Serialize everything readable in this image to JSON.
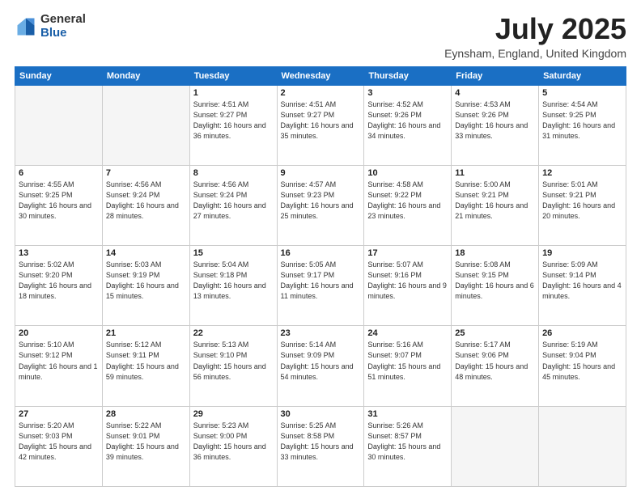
{
  "header": {
    "logo_line1": "General",
    "logo_line2": "Blue",
    "month": "July 2025",
    "location": "Eynsham, England, United Kingdom"
  },
  "days_of_week": [
    "Sunday",
    "Monday",
    "Tuesday",
    "Wednesday",
    "Thursday",
    "Friday",
    "Saturday"
  ],
  "weeks": [
    [
      {
        "day": "",
        "sunrise": "",
        "sunset": "",
        "daylight": ""
      },
      {
        "day": "",
        "sunrise": "",
        "sunset": "",
        "daylight": ""
      },
      {
        "day": "1",
        "sunrise": "Sunrise: 4:51 AM",
        "sunset": "Sunset: 9:27 PM",
        "daylight": "Daylight: 16 hours and 36 minutes."
      },
      {
        "day": "2",
        "sunrise": "Sunrise: 4:51 AM",
        "sunset": "Sunset: 9:27 PM",
        "daylight": "Daylight: 16 hours and 35 minutes."
      },
      {
        "day": "3",
        "sunrise": "Sunrise: 4:52 AM",
        "sunset": "Sunset: 9:26 PM",
        "daylight": "Daylight: 16 hours and 34 minutes."
      },
      {
        "day": "4",
        "sunrise": "Sunrise: 4:53 AM",
        "sunset": "Sunset: 9:26 PM",
        "daylight": "Daylight: 16 hours and 33 minutes."
      },
      {
        "day": "5",
        "sunrise": "Sunrise: 4:54 AM",
        "sunset": "Sunset: 9:25 PM",
        "daylight": "Daylight: 16 hours and 31 minutes."
      }
    ],
    [
      {
        "day": "6",
        "sunrise": "Sunrise: 4:55 AM",
        "sunset": "Sunset: 9:25 PM",
        "daylight": "Daylight: 16 hours and 30 minutes."
      },
      {
        "day": "7",
        "sunrise": "Sunrise: 4:56 AM",
        "sunset": "Sunset: 9:24 PM",
        "daylight": "Daylight: 16 hours and 28 minutes."
      },
      {
        "day": "8",
        "sunrise": "Sunrise: 4:56 AM",
        "sunset": "Sunset: 9:24 PM",
        "daylight": "Daylight: 16 hours and 27 minutes."
      },
      {
        "day": "9",
        "sunrise": "Sunrise: 4:57 AM",
        "sunset": "Sunset: 9:23 PM",
        "daylight": "Daylight: 16 hours and 25 minutes."
      },
      {
        "day": "10",
        "sunrise": "Sunrise: 4:58 AM",
        "sunset": "Sunset: 9:22 PM",
        "daylight": "Daylight: 16 hours and 23 minutes."
      },
      {
        "day": "11",
        "sunrise": "Sunrise: 5:00 AM",
        "sunset": "Sunset: 9:21 PM",
        "daylight": "Daylight: 16 hours and 21 minutes."
      },
      {
        "day": "12",
        "sunrise": "Sunrise: 5:01 AM",
        "sunset": "Sunset: 9:21 PM",
        "daylight": "Daylight: 16 hours and 20 minutes."
      }
    ],
    [
      {
        "day": "13",
        "sunrise": "Sunrise: 5:02 AM",
        "sunset": "Sunset: 9:20 PM",
        "daylight": "Daylight: 16 hours and 18 minutes."
      },
      {
        "day": "14",
        "sunrise": "Sunrise: 5:03 AM",
        "sunset": "Sunset: 9:19 PM",
        "daylight": "Daylight: 16 hours and 15 minutes."
      },
      {
        "day": "15",
        "sunrise": "Sunrise: 5:04 AM",
        "sunset": "Sunset: 9:18 PM",
        "daylight": "Daylight: 16 hours and 13 minutes."
      },
      {
        "day": "16",
        "sunrise": "Sunrise: 5:05 AM",
        "sunset": "Sunset: 9:17 PM",
        "daylight": "Daylight: 16 hours and 11 minutes."
      },
      {
        "day": "17",
        "sunrise": "Sunrise: 5:07 AM",
        "sunset": "Sunset: 9:16 PM",
        "daylight": "Daylight: 16 hours and 9 minutes."
      },
      {
        "day": "18",
        "sunrise": "Sunrise: 5:08 AM",
        "sunset": "Sunset: 9:15 PM",
        "daylight": "Daylight: 16 hours and 6 minutes."
      },
      {
        "day": "19",
        "sunrise": "Sunrise: 5:09 AM",
        "sunset": "Sunset: 9:14 PM",
        "daylight": "Daylight: 16 hours and 4 minutes."
      }
    ],
    [
      {
        "day": "20",
        "sunrise": "Sunrise: 5:10 AM",
        "sunset": "Sunset: 9:12 PM",
        "daylight": "Daylight: 16 hours and 1 minute."
      },
      {
        "day": "21",
        "sunrise": "Sunrise: 5:12 AM",
        "sunset": "Sunset: 9:11 PM",
        "daylight": "Daylight: 15 hours and 59 minutes."
      },
      {
        "day": "22",
        "sunrise": "Sunrise: 5:13 AM",
        "sunset": "Sunset: 9:10 PM",
        "daylight": "Daylight: 15 hours and 56 minutes."
      },
      {
        "day": "23",
        "sunrise": "Sunrise: 5:14 AM",
        "sunset": "Sunset: 9:09 PM",
        "daylight": "Daylight: 15 hours and 54 minutes."
      },
      {
        "day": "24",
        "sunrise": "Sunrise: 5:16 AM",
        "sunset": "Sunset: 9:07 PM",
        "daylight": "Daylight: 15 hours and 51 minutes."
      },
      {
        "day": "25",
        "sunrise": "Sunrise: 5:17 AM",
        "sunset": "Sunset: 9:06 PM",
        "daylight": "Daylight: 15 hours and 48 minutes."
      },
      {
        "day": "26",
        "sunrise": "Sunrise: 5:19 AM",
        "sunset": "Sunset: 9:04 PM",
        "daylight": "Daylight: 15 hours and 45 minutes."
      }
    ],
    [
      {
        "day": "27",
        "sunrise": "Sunrise: 5:20 AM",
        "sunset": "Sunset: 9:03 PM",
        "daylight": "Daylight: 15 hours and 42 minutes."
      },
      {
        "day": "28",
        "sunrise": "Sunrise: 5:22 AM",
        "sunset": "Sunset: 9:01 PM",
        "daylight": "Daylight: 15 hours and 39 minutes."
      },
      {
        "day": "29",
        "sunrise": "Sunrise: 5:23 AM",
        "sunset": "Sunset: 9:00 PM",
        "daylight": "Daylight: 15 hours and 36 minutes."
      },
      {
        "day": "30",
        "sunrise": "Sunrise: 5:25 AM",
        "sunset": "Sunset: 8:58 PM",
        "daylight": "Daylight: 15 hours and 33 minutes."
      },
      {
        "day": "31",
        "sunrise": "Sunrise: 5:26 AM",
        "sunset": "Sunset: 8:57 PM",
        "daylight": "Daylight: 15 hours and 30 minutes."
      },
      {
        "day": "",
        "sunrise": "",
        "sunset": "",
        "daylight": ""
      },
      {
        "day": "",
        "sunrise": "",
        "sunset": "",
        "daylight": ""
      }
    ]
  ]
}
